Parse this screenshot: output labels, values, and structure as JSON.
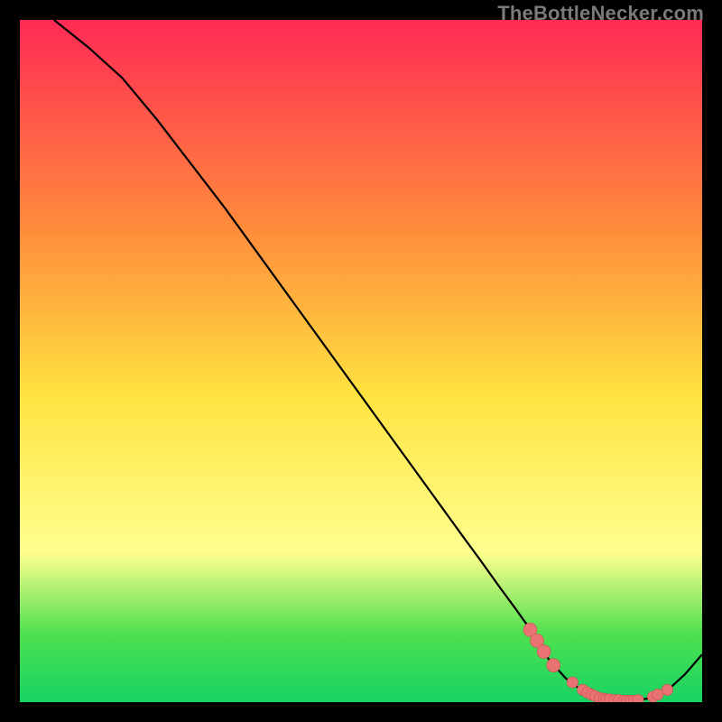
{
  "watermark": "TheBottleNecker.com",
  "colors": {
    "black": "#000000",
    "curve": "#000000",
    "marker_fill": "#e97373",
    "marker_stroke": "#cc4f4f",
    "grad_top": "#ff2a55",
    "grad_mid_upper": "#ff8a3c",
    "grad_mid": "#ffe341",
    "grad_low_yellow": "#ffff8f",
    "grad_green1": "#4fe04f",
    "grad_green2": "#17d463"
  },
  "chart_data": {
    "type": "line",
    "title": "",
    "xlabel": "",
    "ylabel": "",
    "xlim": [
      0,
      100
    ],
    "ylim": [
      0,
      100
    ],
    "curve": {
      "name": "bottleneck-curve",
      "x": [
        5,
        10,
        15,
        20,
        25,
        30,
        35,
        40,
        45,
        50,
        55,
        60,
        65,
        67.5,
        70,
        72.5,
        75,
        77.5,
        80,
        82.5,
        85,
        87.5,
        90,
        92.5,
        95,
        97.5,
        100
      ],
      "y": [
        100,
        96,
        91.5,
        85.5,
        79,
        72.5,
        65.6,
        58.7,
        51.8,
        44.9,
        38,
        31.1,
        24.2,
        20.8,
        17.3,
        13.9,
        10.4,
        6.3,
        3.5,
        1.6,
        0.6,
        0.2,
        0.2,
        0.6,
        1.8,
        4.1,
        7
      ]
    },
    "markers": {
      "name": "highlight-points",
      "x": [
        74.8,
        75.8,
        76.8,
        78.2,
        81,
        82.5,
        83.2,
        83.8,
        84.3,
        85,
        85.6,
        86,
        86.5,
        87.2,
        87.8,
        88.5,
        89,
        89.5,
        90,
        90.6,
        92.8,
        93.5,
        94.9
      ],
      "y": [
        10.6,
        9.0,
        7.4,
        5.4,
        2.9,
        1.8,
        1.4,
        1.1,
        0.9,
        0.6,
        0.5,
        0.4,
        0.4,
        0.3,
        0.3,
        0.2,
        0.2,
        0.2,
        0.2,
        0.3,
        0.8,
        1.1,
        1.8
      ]
    },
    "gradient_stops": [
      {
        "offset": 0.0,
        "color": "#ff2a55"
      },
      {
        "offset": 0.3,
        "color": "#ff8a3c"
      },
      {
        "offset": 0.55,
        "color": "#ffe341"
      },
      {
        "offset": 0.78,
        "color": "#ffff8f"
      },
      {
        "offset": 0.9,
        "color": "#4fe04f"
      },
      {
        "offset": 1.0,
        "color": "#17d463"
      }
    ]
  }
}
